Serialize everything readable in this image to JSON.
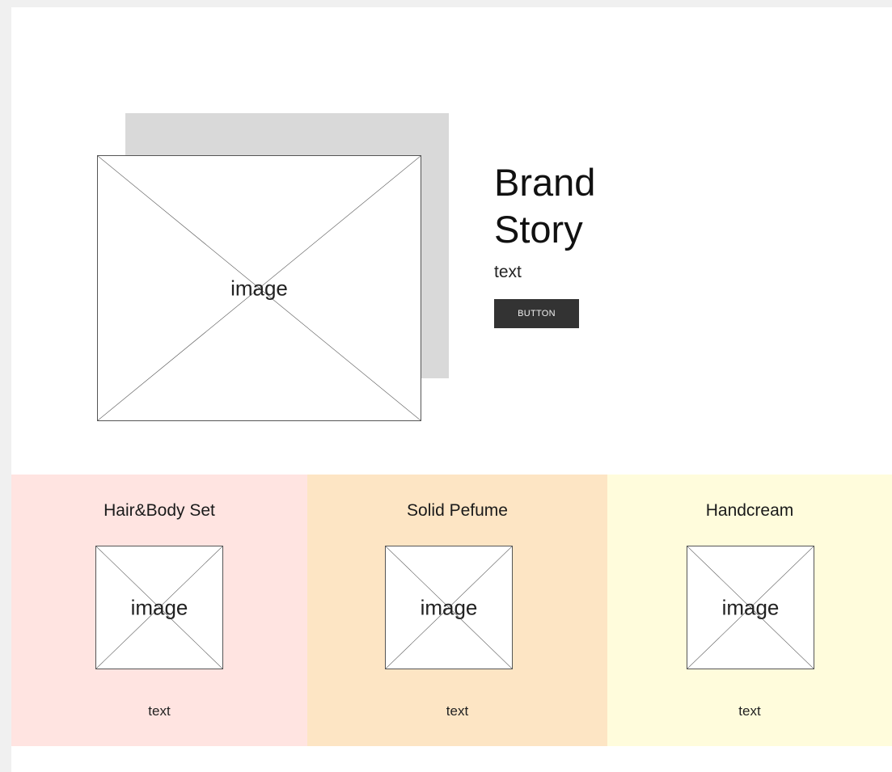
{
  "hero": {
    "image_label": "image",
    "title": "Brand Story",
    "text": "text",
    "button_label": "BUTTON"
  },
  "products": [
    {
      "title": "Hair&Body Set",
      "image_label": "image",
      "text": "text",
      "bg_color": "#ffe4e1"
    },
    {
      "title": "Solid Pefume",
      "image_label": "image",
      "text": "text",
      "bg_color": "#fde5c4"
    },
    {
      "title": "Handcream",
      "image_label": "image",
      "text": "text",
      "bg_color": "#fffcdc"
    }
  ],
  "colors": {
    "page_background": "#f0f0f0",
    "canvas": "#ffffff",
    "shadow_box": "#d9d9d9",
    "button": "#333333"
  }
}
